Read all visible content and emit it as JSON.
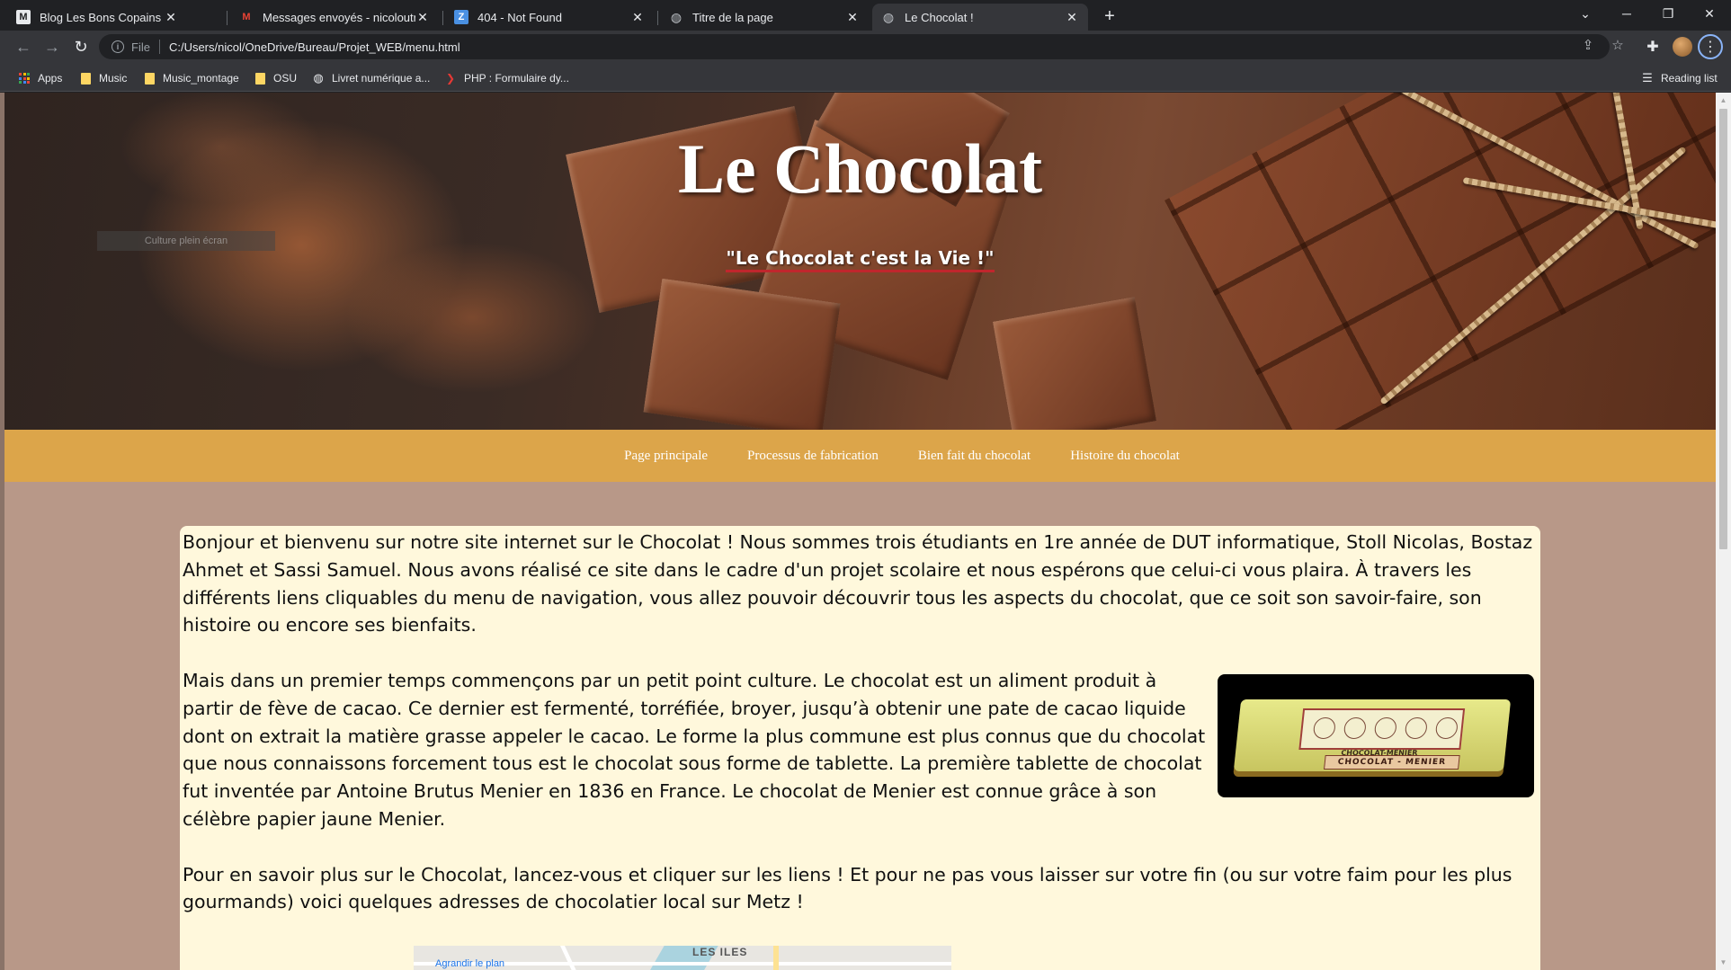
{
  "browser": {
    "tabs": [
      {
        "title": "Blog Les Bons Copains",
        "favicon": "blog-icon",
        "active": false
      },
      {
        "title": "Messages envoyés - nicoloutreec",
        "favicon": "gmail-icon",
        "active": false
      },
      {
        "title": "404 - Not Found",
        "favicon": "z-icon",
        "active": false
      },
      {
        "title": "Titre de la page",
        "favicon": "globe-icon",
        "active": false
      },
      {
        "title": "Le Chocolat !",
        "favicon": "globe-icon",
        "active": true
      }
    ],
    "address": {
      "scheme": "File",
      "url": "C:/Users/nicol/OneDrive/Bureau/Projet_WEB/menu.html"
    },
    "bookmarks": [
      {
        "label": "Apps",
        "icon": "apps-icon"
      },
      {
        "label": "Music",
        "icon": "folder-icon"
      },
      {
        "label": "Music_montage",
        "icon": "folder-icon"
      },
      {
        "label": "OSU",
        "icon": "folder-icon"
      },
      {
        "label": "Livret numérique a...",
        "icon": "globe-icon"
      },
      {
        "label": "PHP : Formulaire dy...",
        "icon": "php-icon"
      }
    ],
    "reading_list": "Reading list"
  },
  "page": {
    "hero": {
      "title": "Le Chocolat",
      "slogan": "\"Le Chocolat c'est la Vie !\"",
      "fullscreen_button": "Culture plein écran"
    },
    "nav": [
      "Page principale",
      "Processus de fabrication",
      "Bien fait du chocolat",
      "Histoire du chocolat"
    ],
    "paragraphs": [
      "Bonjour et bienvenu sur notre site internet sur le Chocolat ! Nous sommes trois étudiants en 1re année de DUT informatique, Stoll Nicolas, Bostaz Ahmet et Sassi Samuel. Nous avons réalisé ce site dans le cadre d'un projet scolaire et nous espérons que celui-ci vous plaira. À travers les différents liens cliquables du menu de navigation, vous allez pouvoir découvrir tous les aspects du chocolat, que ce soit son savoir-faire, son histoire ou encore ses bienfaits.",
      "Mais dans un premier temps commençons par un petit point culture. Le chocolat est un aliment produit à partir de fève de cacao. Ce dernier est fermenté, torréfiée, broyer, jusqu’à obtenir une pate de cacao liquide dont on extrait la matière grasse appeler le cacao. Le forme la plus commune est plus connus que du chocolat que nous connaissons forcement tous est le chocolat sous forme de tablette. La première tablette de chocolat fut inventée par Antoine Brutus Menier en 1836 en France. Le chocolat de Menier est connue grâce à son célèbre papier jaune Menier.",
      "Pour en savoir plus sur le Chocolat, lancez-vous et cliquer sur les liens ! Et pour ne pas vous laisser sur votre fin (ou sur votre faim pour les plus gourmands) voici quelques adresses de chocolatier local sur Metz !"
    ],
    "menier_image": {
      "label_top": "CHOCOLAT-MENIER",
      "label_bottom": "CHOCOLAT - MENIER"
    },
    "map": {
      "enlarge_link": "Agrandir le plan",
      "place": "LES ILES"
    }
  },
  "colors": {
    "nav_bg": "#dca54a",
    "page_bg": "#b89888",
    "content_bg": "#fff8dc",
    "slogan_underline": "#c0262d"
  }
}
